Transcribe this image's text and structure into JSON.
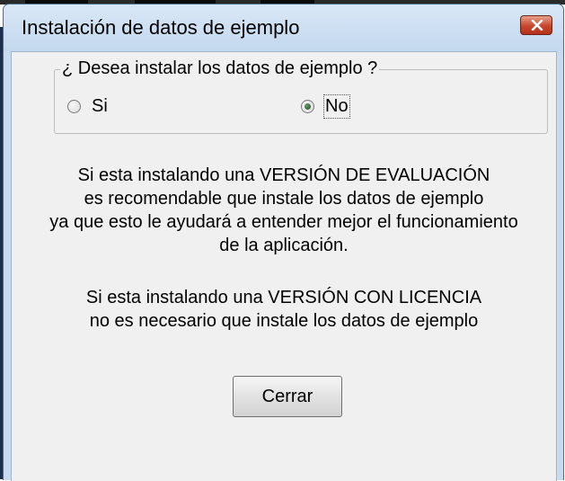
{
  "window": {
    "title": "Instalación de datos de ejemplo"
  },
  "group": {
    "legend": "¿ Desea instalar los datos de ejemplo ?",
    "options": [
      {
        "label": "Si",
        "selected": false
      },
      {
        "label": "No",
        "selected": true
      }
    ]
  },
  "message": {
    "evaluation": [
      "Si esta instalando una VERSIÓN DE EVALUACIÓN",
      "es recomendable que instale los datos de ejemplo",
      "ya que esto le ayudará a entender mejor el funcionamiento",
      "de la aplicación."
    ],
    "licensed": [
      "Si esta instalando una VERSIÓN CON LICENCIA",
      "no es necesario que instale los datos de ejemplo"
    ]
  },
  "buttons": {
    "close": "Cerrar"
  },
  "icons": {
    "close": "close-icon",
    "radio": "radio-button"
  },
  "colors": {
    "close_button": "#c8452c",
    "titlebar": "#c8daee",
    "client": "#f0f0f0"
  }
}
